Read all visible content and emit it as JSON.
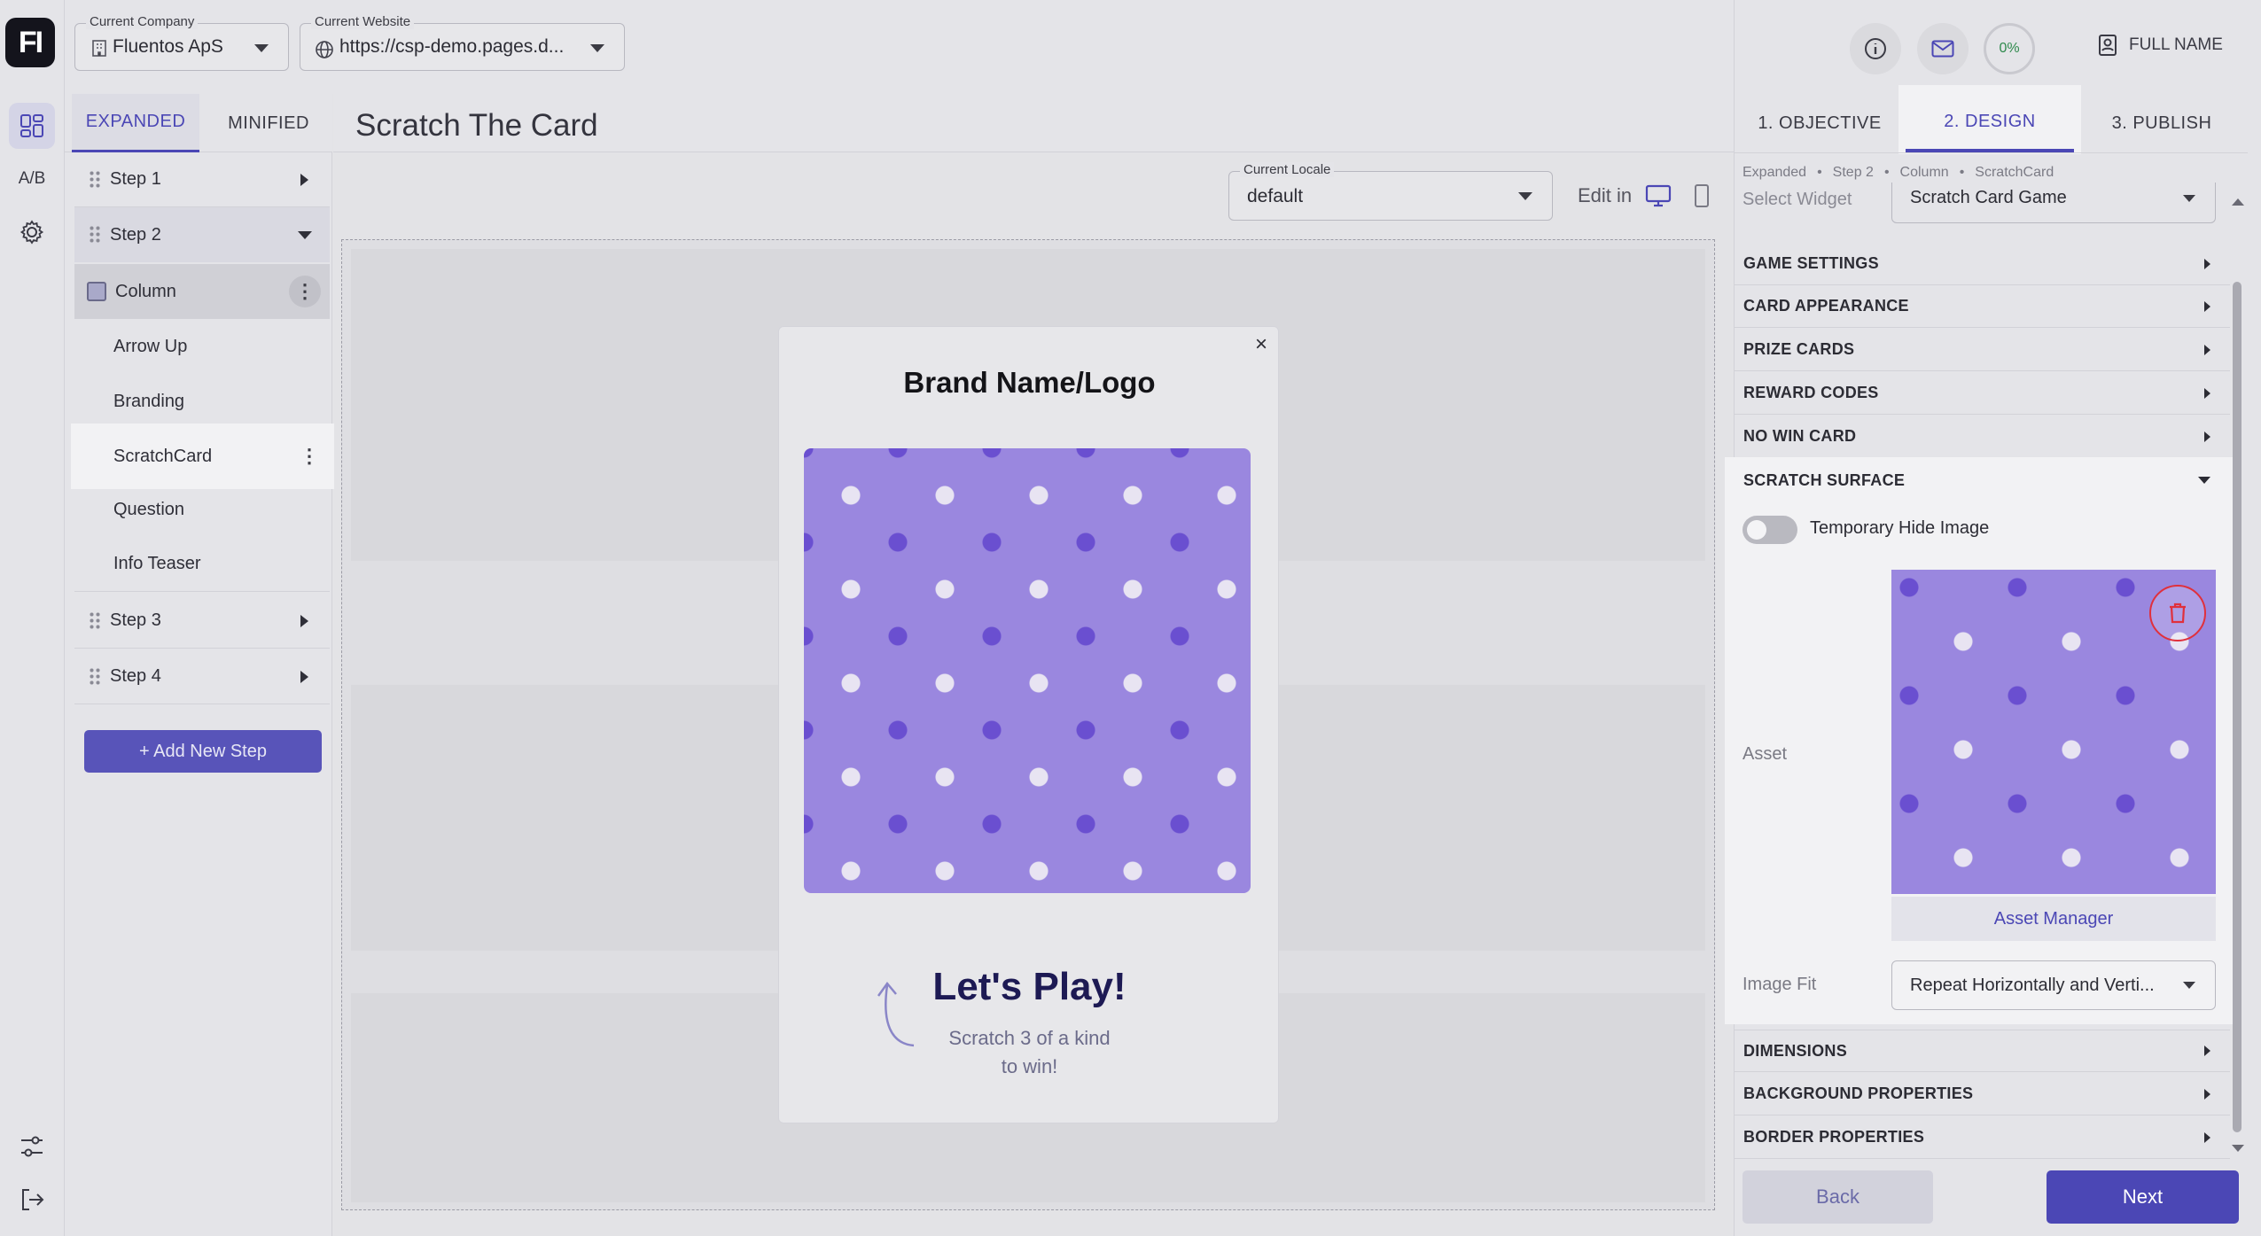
{
  "app": {
    "logo": "FI"
  },
  "rail": {
    "ab_label": "A/B"
  },
  "header": {
    "company": {
      "label": "Current Company",
      "value": "Fluentos ApS"
    },
    "website": {
      "label": "Current Website",
      "value": "https://csp-demo.pages.d..."
    },
    "progress": "0%",
    "user_name": "FULL NAME"
  },
  "left": {
    "tabs": [
      "EXPANDED",
      "MINIFIED"
    ],
    "steps": {
      "s1": "Step 1",
      "s2": "Step 2",
      "s3": "Step 3",
      "s4": "Step 4"
    },
    "children": {
      "column": "Column",
      "arrow_up": "Arrow Up",
      "branding": "Branding",
      "scratchcard": "ScratchCard",
      "question": "Question",
      "info_teaser": "Info Teaser"
    },
    "add_step": "+ Add New Step"
  },
  "center": {
    "title": "Scratch The Card",
    "locale": {
      "label": "Current Locale",
      "value": "default"
    },
    "edit_in": "Edit in",
    "preview": {
      "brand": "Brand Name/Logo",
      "close": "×",
      "headline": "Let's Play!",
      "line1": "Scratch 3 of a kind",
      "line2": "to win!"
    }
  },
  "right": {
    "tabs": [
      "1. OBJECTIVE",
      "2. DESIGN",
      "3. PUBLISH"
    ],
    "breadcrumb": [
      "Expanded",
      "Step 2",
      "Column",
      "ScratchCard"
    ],
    "select_widget_label": "Select Widget",
    "select_widget_value": "Scratch Card Game",
    "sections": [
      "GAME SETTINGS",
      "CARD APPEARANCE",
      "PRIZE CARDS",
      "REWARD CODES",
      "NO WIN CARD"
    ],
    "scratch_surface": "SCRATCH SURFACE",
    "toggle_label": "Temporary Hide Image",
    "toggle_on": false,
    "asset_label": "Asset",
    "asset_manager": "Asset Manager",
    "image_fit_label": "Image Fit",
    "image_fit_value": "Repeat Horizontally and Verti...",
    "more_sections": [
      "DIMENSIONS",
      "BACKGROUND PROPERTIES",
      "BORDER PROPERTIES"
    ],
    "back": "Back",
    "next": "Next"
  },
  "colors": {
    "accent": "#4b47b5",
    "polka_bg": "#9a87df",
    "dot_dark": "#6a4fd0",
    "dot_light": "#e8e4f2"
  }
}
